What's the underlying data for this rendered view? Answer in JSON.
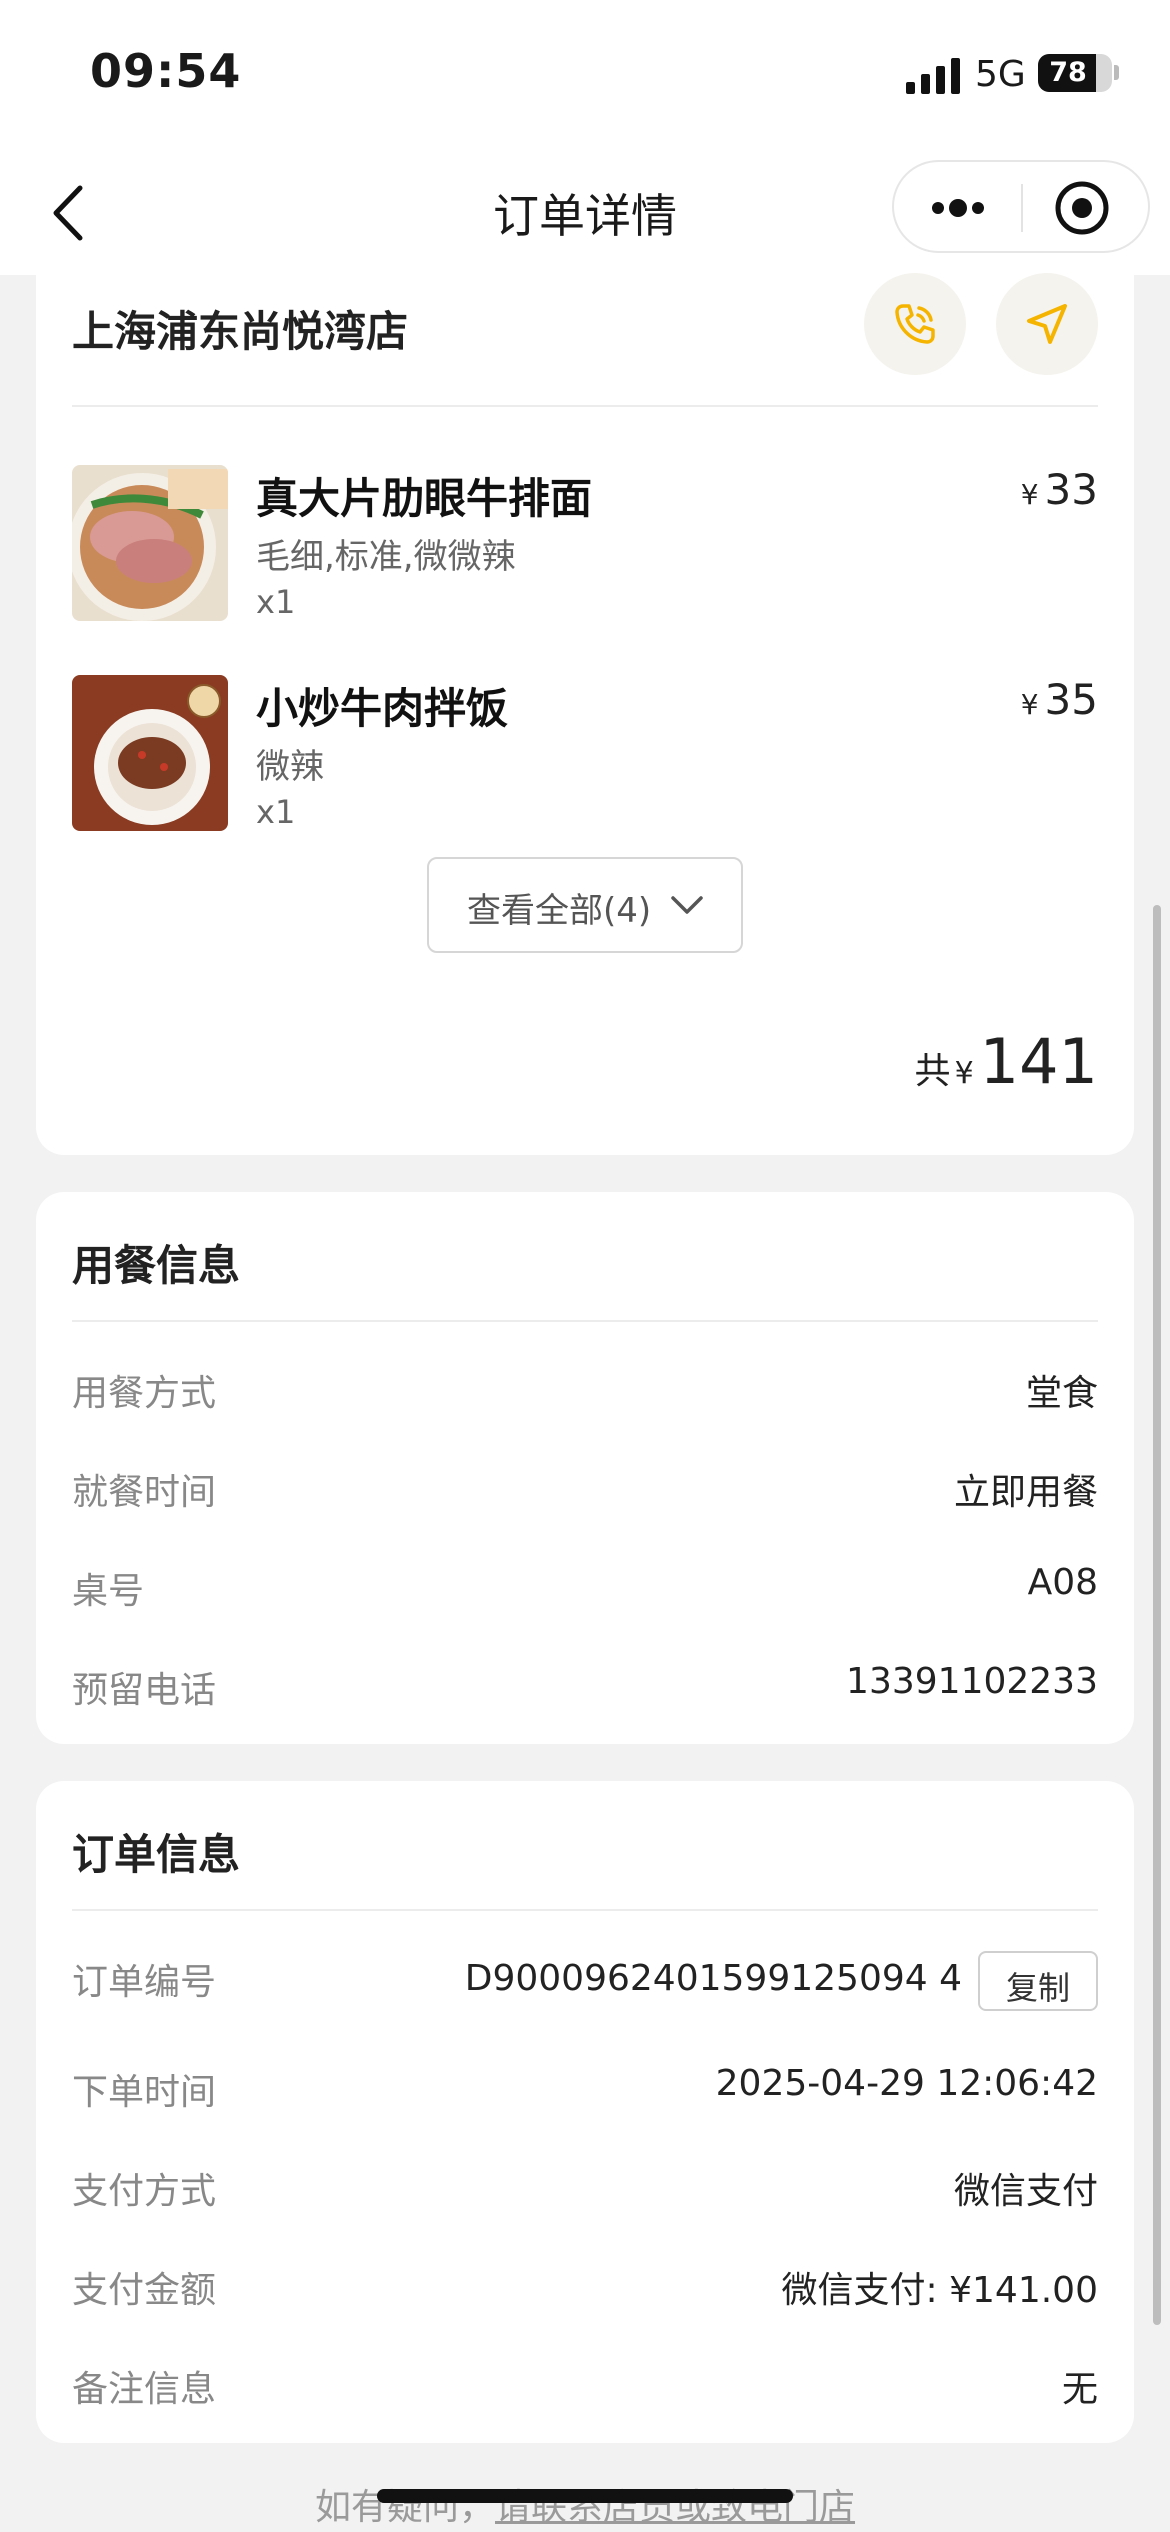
{
  "status_bar": {
    "time": "09:54",
    "network": "5G",
    "battery": "78",
    "battery_level": 0.78
  },
  "nav": {
    "title": "订单详情"
  },
  "store": {
    "name": "上海浦东尚悦湾店",
    "items": [
      {
        "name": "真大片肋眼牛排面",
        "spec": "毛细,标准,微微辣",
        "qty": "x1",
        "price": "33",
        "currency": "¥"
      },
      {
        "name": "小炒牛肉拌饭",
        "spec": "微辣",
        "qty": "x1",
        "price": "35",
        "currency": "¥"
      }
    ],
    "view_all_label": "查看全部(4)",
    "total_label": "共",
    "total_currency": "¥",
    "total_amount": "141"
  },
  "dining": {
    "title": "用餐信息",
    "rows": [
      {
        "label": "用餐方式",
        "value": "堂食"
      },
      {
        "label": "就餐时间",
        "value": "立即用餐"
      },
      {
        "label": "桌号",
        "value": "A08"
      },
      {
        "label": "预留电话",
        "value": "13391102233"
      }
    ]
  },
  "order": {
    "title": "订单信息",
    "rows": [
      {
        "label": "订单编号",
        "value": "D9000962401599125094 4"
      },
      {
        "label": "下单时间",
        "value": "2025-04-29 12:06:42"
      },
      {
        "label": "支付方式",
        "value": "微信支付"
      },
      {
        "label": "支付金额",
        "value": "微信支付: ¥141.00"
      },
      {
        "label": "备注信息",
        "value": "无"
      }
    ],
    "copy_label": "复制"
  },
  "footer": {
    "prefix": "如有疑问，",
    "link": "请联系店员或致电门店"
  },
  "colors": {
    "accent": "#f5b400",
    "background": "#f2f2f2"
  }
}
